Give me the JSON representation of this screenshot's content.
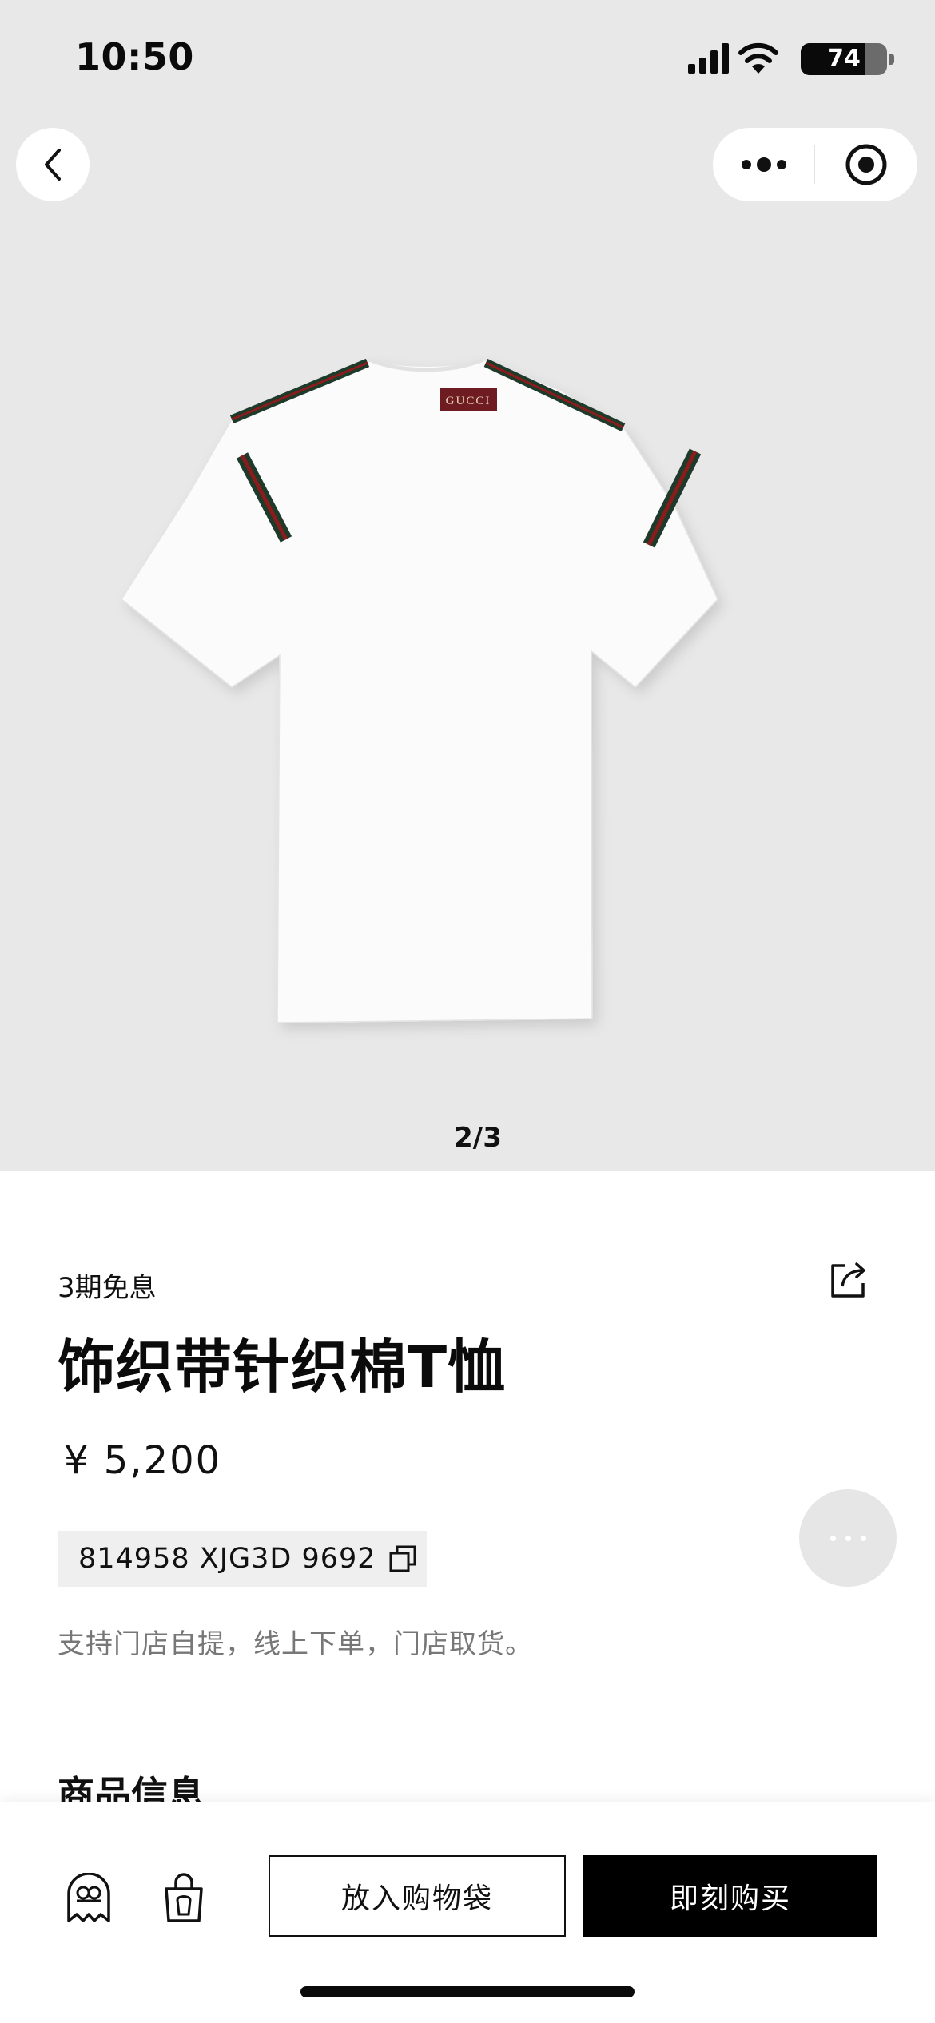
{
  "status_bar": {
    "time": "10:50",
    "battery_level": "74",
    "icons": [
      "signal-icon",
      "wifi-icon",
      "battery-icon"
    ]
  },
  "nav": {
    "back_icon": "chevron-left-icon",
    "capsule_icons": [
      "more-dots-icon",
      "close-target-icon"
    ]
  },
  "gallery": {
    "counter": "2/3",
    "current": 2,
    "total": 3,
    "label_brand": "GUCCI"
  },
  "product": {
    "installment": "3期免息",
    "title": "饰织带针织棉T恤",
    "price": "¥ 5,200",
    "sku": "814958 XJG3D 9692",
    "pickup_note": "支持门店自提，线上下单，门店取货。",
    "section_heading": "商品信息"
  },
  "float_button": {
    "icon": "ellipsis-icon"
  },
  "bottom_bar": {
    "add_to_bag": "放入购物袋",
    "buy_now": "即刻购买",
    "icons": [
      "ghost-icon",
      "shopping-bag-icon"
    ]
  },
  "colors": {
    "hero_background": "#e8e8e8",
    "primary_button": "#000000",
    "muted_text": "#777777",
    "sku_background": "#efefef",
    "stripe_red": "#8a1c1c",
    "stripe_green": "#1e3a2a"
  }
}
